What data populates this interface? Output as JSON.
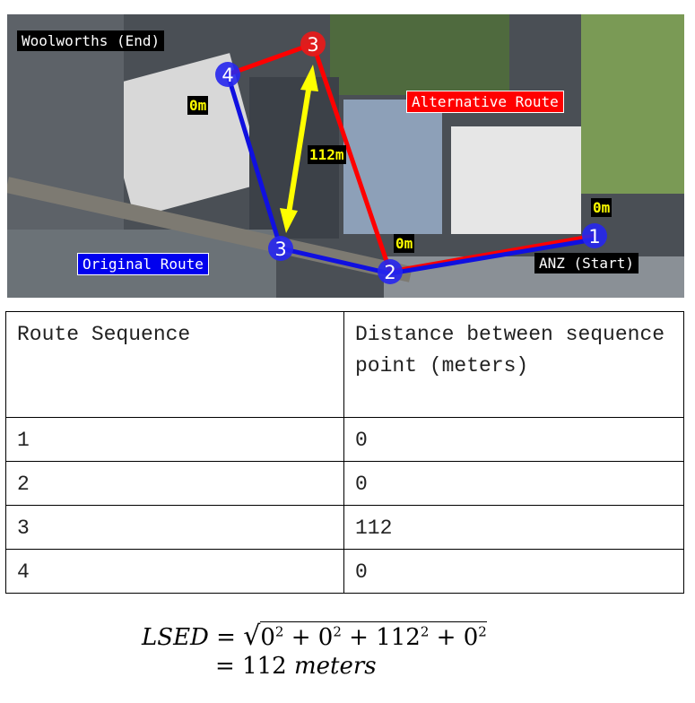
{
  "map": {
    "labels": {
      "end": "Woolworths (End)",
      "start": "ANZ (Start)",
      "alternative": "Alternative Route",
      "original": "Original Route"
    },
    "distances": [
      "0m",
      "0m",
      "112m",
      "0m"
    ],
    "points": {
      "original": [
        "1",
        "2",
        "3",
        "4"
      ],
      "alternative": [
        "3"
      ]
    },
    "colors": {
      "original": "#1010e0",
      "alternative": "#ff0000",
      "difference": "#ffff00"
    }
  },
  "table": {
    "headers": [
      "Route Sequence",
      "Distance between sequence point (meters)"
    ],
    "rows": [
      [
        "1",
        "0"
      ],
      [
        "2",
        "0"
      ],
      [
        "3",
        "112"
      ],
      [
        "4",
        "0"
      ]
    ]
  },
  "formula": {
    "lhs": "LSED",
    "eq": "=",
    "terms": [
      "0",
      "0",
      "112",
      "0"
    ],
    "exp": "2",
    "plus": "+",
    "result": "112",
    "unit": "meters"
  }
}
